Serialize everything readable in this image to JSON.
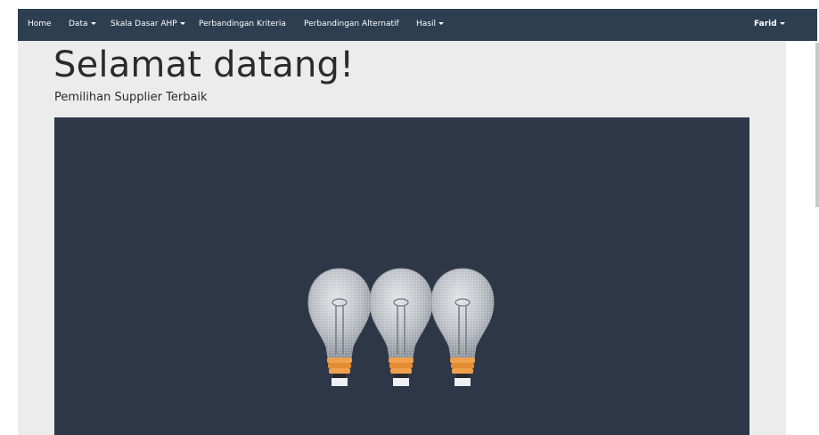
{
  "navbar": {
    "items": [
      {
        "label": "Home",
        "dropdown": false
      },
      {
        "label": "Data",
        "dropdown": true
      },
      {
        "label": "Skala Dasar AHP",
        "dropdown": true
      },
      {
        "label": "Perbandingan Kriteria",
        "dropdown": false
      },
      {
        "label": "Perbandingan Alternatif",
        "dropdown": false
      },
      {
        "label": "Hasil",
        "dropdown": true
      }
    ],
    "user": {
      "label": "Farid",
      "dropdown": true
    }
  },
  "jumbotron": {
    "title": "Selamat datang!",
    "subtitle": "Pemilihan Supplier Terbaik"
  },
  "hero": {
    "image": "three-light-bulbs",
    "background": "#2d3747"
  },
  "colors": {
    "navbar": "#2c3e50",
    "jumbotron": "#ececec",
    "bulb_glass": "#c9ccd0",
    "bulb_base": "#f0a04b"
  }
}
